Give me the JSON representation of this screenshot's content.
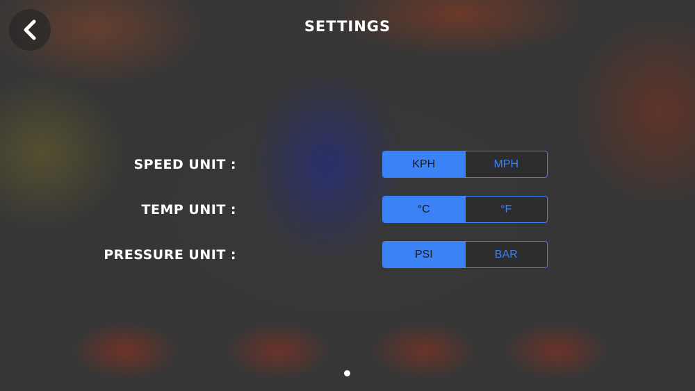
{
  "header": {
    "title": "SETTINGS",
    "back_icon": "chevron-left-icon"
  },
  "settings": [
    {
      "label": "SPEED UNIT :",
      "options": [
        "KPH",
        "MPH"
      ],
      "selected": "KPH"
    },
    {
      "label": "TEMP UNIT :",
      "options": [
        "°C",
        "°F"
      ],
      "selected": "°C"
    },
    {
      "label": "PRESSURE UNIT :",
      "options": [
        "PSI",
        "BAR"
      ],
      "selected": "PSI"
    }
  ],
  "pagination": {
    "pages": 1,
    "current": 1
  },
  "colors": {
    "accent": "#3b82f6",
    "text": "#ffffff"
  }
}
